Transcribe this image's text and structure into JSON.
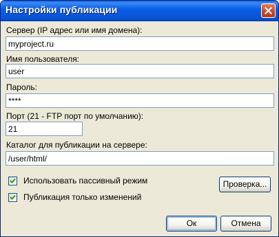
{
  "window": {
    "title": "Настройки публикации"
  },
  "form": {
    "server_label": "Сервер (IP адрес или имя домена):",
    "server_value": "myproject.ru",
    "username_label": "Имя пользователя:",
    "username_value": "user",
    "password_label": "Пароль:",
    "password_value": "****",
    "port_label": "Порт (21 - FTP порт по умолчанию):",
    "port_value": "21",
    "directory_label": "Каталог для публикации на сервере:",
    "directory_value": "/user/html/"
  },
  "options": {
    "passive_mode_label": "Использовать пассивный режим",
    "passive_mode_checked": true,
    "changes_only_label": "Публикация только изменений",
    "changes_only_checked": true
  },
  "buttons": {
    "check_label": "Проверка...",
    "ok_label": "Ок",
    "cancel_label": "Отмена"
  },
  "colors": {
    "titlebar": "#0a5ee8",
    "close_button": "#c9441f",
    "dialog_background": "#ece9d8",
    "field_border": "#7f9db9"
  },
  "icons": {
    "close": "close-icon",
    "checkmark": "checkmark-icon"
  }
}
